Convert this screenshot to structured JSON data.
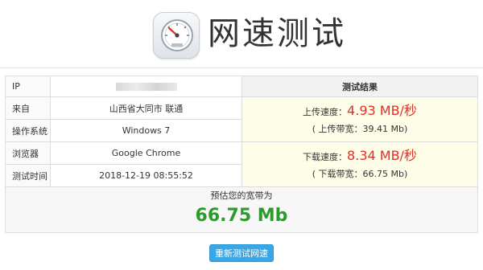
{
  "header": {
    "title": "网速测试",
    "icon": "speedometer-icon"
  },
  "table": {
    "rows": [
      {
        "label": "IP",
        "value": ""
      },
      {
        "label": "来自",
        "value": "山西省大同市 联通"
      },
      {
        "label": "操作系统",
        "value": "Windows 7"
      },
      {
        "label": "浏览器",
        "value": "Google Chrome"
      },
      {
        "label": "测试时间",
        "value": "2018-12-19 08:55:52"
      }
    ],
    "result_header": "测试结果",
    "upload": {
      "label": "上传速度：",
      "speed": "4.93 MB/秒",
      "bandwidth": "( 上传带宽：39.41 Mb)"
    },
    "download": {
      "label": "下载速度：",
      "speed": "8.34 MB/秒",
      "bandwidth": "( 下载带宽：66.75 Mb)"
    },
    "estimate_label": "预估您的宽带为",
    "estimate_value": "66.75 Mb"
  },
  "retest_button": "重新测试网速",
  "colors": {
    "speed": "#e0302a",
    "estimate": "#2e9a2e",
    "button": "#3aa7e5",
    "result_bg": "#fdfde8"
  }
}
